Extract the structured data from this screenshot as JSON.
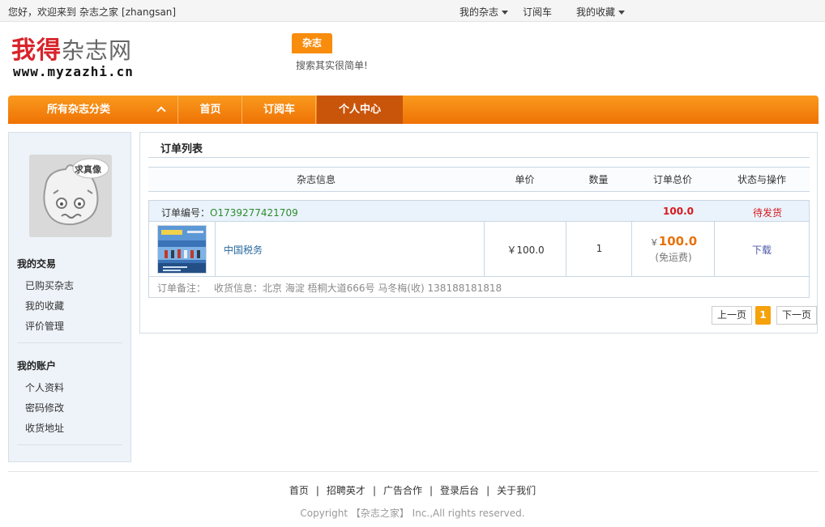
{
  "topbar": {
    "greeting": "您好，欢迎来到",
    "site_name": "杂志之家",
    "username": "[zhangsan]",
    "nav": [
      "我的杂志",
      "订阅车",
      "我的收藏"
    ]
  },
  "header": {
    "logo_cn_1": "我得",
    "logo_cn_2": "杂志网",
    "logo_url": "www.myzazhi.cn",
    "search_tab": "杂志",
    "search_hint": "搜索其实很简单!"
  },
  "mainnav": {
    "category": "所有杂志分类",
    "items": [
      "首页",
      "订阅车",
      "个人中心"
    ],
    "active": "个人中心"
  },
  "sidebar": {
    "avatar_text": "求真像",
    "section1_title": "我的交易",
    "section1_links": [
      "已购买杂志",
      "我的收藏",
      "评价管理"
    ],
    "section2_title": "我的账户",
    "section2_links": [
      "个人资料",
      "密码修改",
      "收货地址"
    ]
  },
  "content": {
    "title": "订单列表",
    "columns": [
      "杂志信息",
      "单价",
      "数量",
      "订单总价",
      "状态与操作"
    ],
    "order": {
      "no_label": "订单编号：",
      "no": "O1739277421709",
      "total_head": "100.0",
      "status": "待发货",
      "magazine": "中国税务",
      "unit_price": "￥100.0",
      "qty": "1",
      "currency": "￥",
      "total": "100.0",
      "shipping": "(免运费)",
      "action": "下载",
      "remark_label": "订单备注：",
      "receiver": "收货信息：北京 海淀 梧桐大道666号 马冬梅(收) 138188181818"
    },
    "pager": {
      "prev": "上一页",
      "current": "1",
      "next": "下一页"
    }
  },
  "footer": {
    "links": [
      "首页",
      "招聘英才",
      "广告合作",
      "登录后台",
      "关于我们"
    ],
    "copyright": "Copyright 【杂志之家】 Inc.,All rights reserved."
  },
  "colors": {
    "accent": "#f88c0c",
    "nav_active": "#c9550b",
    "price": "#e8730c",
    "status": "#d8181e"
  }
}
